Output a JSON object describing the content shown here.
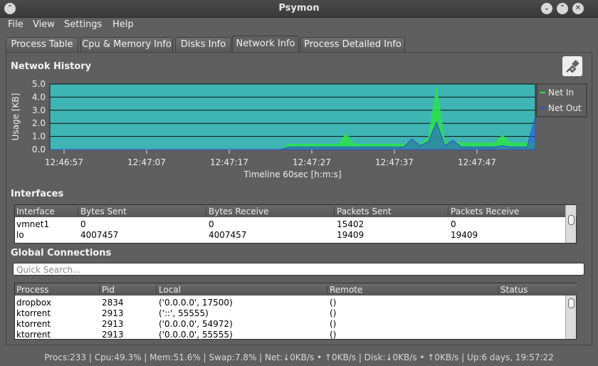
{
  "window": {
    "title": "Psymon"
  },
  "menu": [
    {
      "label": "File"
    },
    {
      "label": "View"
    },
    {
      "label": "Settings"
    },
    {
      "label": "Help"
    }
  ],
  "tabs": [
    {
      "label": "Process Table"
    },
    {
      "label": "Cpu & Memory Info"
    },
    {
      "label": "Disks Info"
    },
    {
      "label": "Network Info",
      "active": true
    },
    {
      "label": "Process Detailed Info"
    }
  ],
  "network_history": {
    "title": "Netwok History"
  },
  "chart_data": {
    "type": "area",
    "title": "",
    "xlabel": "Timeline 60sec [h:m:s]",
    "ylabel": "Usage [KB]",
    "ylim": [
      0,
      5
    ],
    "yticks": [
      "0.0",
      "1.0",
      "2.0",
      "3.0",
      "4.0",
      "5.0"
    ],
    "xtick_labels": [
      "12:46:57",
      "12:47:07",
      "12:47:17",
      "12:47:27",
      "12:47:37",
      "12:47:47"
    ],
    "grid": true,
    "legend_position": "right",
    "colors": {
      "background": "#3fb4b4",
      "net_in": "#2ee050",
      "net_out": "#2b4fd8"
    },
    "x": [
      0,
      1,
      2,
      3,
      4,
      5,
      6,
      7,
      8,
      9,
      10,
      11,
      12,
      13,
      14,
      15,
      16,
      17,
      18,
      19,
      20,
      21,
      22,
      23,
      24,
      25,
      26,
      27,
      28,
      29,
      30,
      31,
      32,
      33,
      34,
      35,
      36,
      37,
      38,
      39,
      40,
      41,
      42,
      43,
      44,
      45,
      46,
      47,
      48,
      49,
      50,
      51,
      52,
      53,
      54,
      55,
      56,
      57,
      58,
      59
    ],
    "series": [
      {
        "name": "Net In",
        "values": [
          0,
          0,
          0,
          0,
          0,
          0,
          0,
          0,
          0,
          0,
          0,
          0,
          0,
          0,
          0,
          0,
          0,
          0,
          0,
          0,
          0,
          0,
          0,
          0,
          0,
          0,
          0,
          0,
          0,
          0.4,
          0.4,
          0.4,
          0.4,
          0.4,
          0.4,
          0.4,
          1.2,
          0.4,
          0.4,
          0.4,
          0.4,
          0.4,
          0.4,
          0.4,
          0.7,
          0.4,
          0.9,
          4.8,
          0.5,
          0.6,
          0.5,
          0.5,
          0.5,
          0.5,
          0.5,
          1.1,
          0.5,
          0.5,
          0.5,
          0.5
        ]
      },
      {
        "name": "Net Out",
        "values": [
          0,
          0,
          0,
          0,
          0,
          0,
          0,
          0,
          0,
          0,
          0,
          0,
          0,
          0,
          0,
          0,
          0,
          0,
          0,
          0,
          0,
          0,
          0,
          0,
          0,
          0,
          0,
          0,
          0,
          0.2,
          0.2,
          0.2,
          0.2,
          0.2,
          0.2,
          0.2,
          0.2,
          0.2,
          0.2,
          0.2,
          0.2,
          0.2,
          0.2,
          0.2,
          0.8,
          0.3,
          0.6,
          2.1,
          0.3,
          0.7,
          0.2,
          0.2,
          0.2,
          0.2,
          0.2,
          0.3,
          0.2,
          0.2,
          0.2,
          2.5
        ]
      }
    ]
  },
  "interfaces": {
    "title": "Interfaces",
    "columns": [
      "Interface",
      "Bytes Sent",
      "Bytes Receive",
      "Packets Sent",
      "Packets Receive"
    ],
    "rows": [
      [
        "vmnet1",
        "0",
        "0",
        "15402",
        "0"
      ],
      [
        "lo",
        "4007457",
        "4007457",
        "19409",
        "19409"
      ]
    ]
  },
  "connections": {
    "title": "Global Connections",
    "search_placeholder": "Quick Search...",
    "columns": [
      "Process",
      "Pid",
      "Local",
      "Remote",
      "Status"
    ],
    "rows": [
      [
        "dropbox",
        "2834",
        "('0.0.0.0', 17500)",
        "()",
        ""
      ],
      [
        "ktorrent",
        "2913",
        "('::', 55555)",
        "()",
        ""
      ],
      [
        "ktorrent",
        "2913",
        "('0.0.0.0', 54972)",
        "()",
        ""
      ],
      [
        "ktorrent",
        "2913",
        "('0.0.0.0', 55555)",
        "()",
        ""
      ]
    ]
  },
  "status_bar": "Procs:233 | Cpu:49.3% | Mem:51.6% | Swap:7.8% | Net:↓0KB/s • ↑0KB/s | Disk:↓0KB/s • ↑0KB/s | Up:6 days, 19:57:22"
}
